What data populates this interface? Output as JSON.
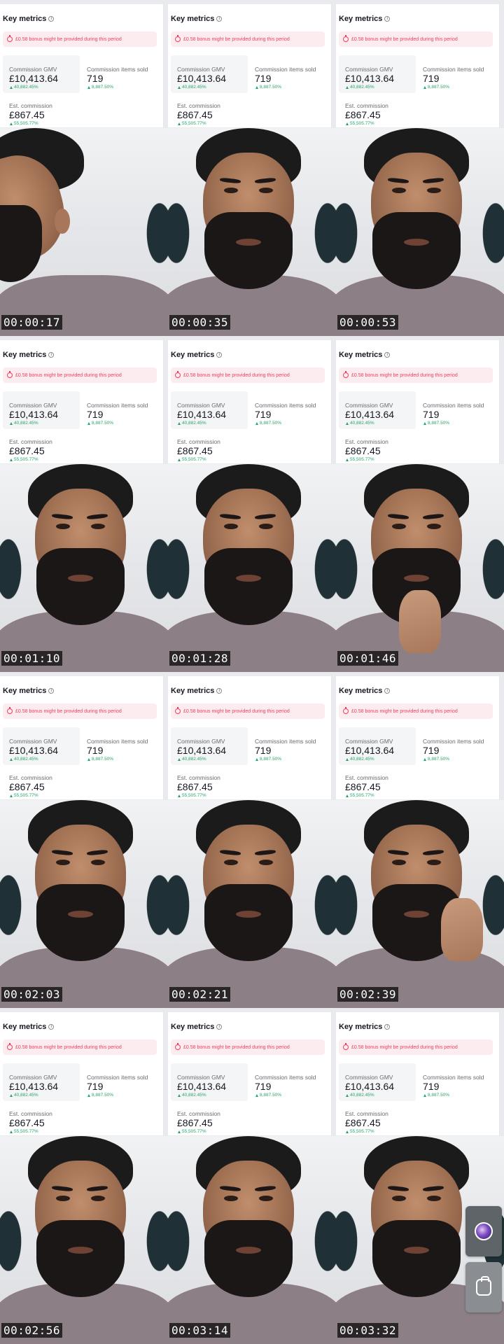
{
  "card": {
    "title": "Key metrics",
    "bonus_text": "£0.58 bonus might be provided during this period",
    "gmv_label": "Commission GMV",
    "gmv_value": "£10,413.64",
    "gmv_change": "40,882.45%",
    "items_label": "Commission items sold",
    "items_value": "719",
    "items_change": "8,887.50%",
    "est_label": "Est. commission",
    "est_value": "£867.45",
    "est_change": "55,505.77%"
  },
  "timestamps": [
    "00:00:17",
    "00:00:35",
    "00:00:53",
    "00:01:10",
    "00:01:28",
    "00:01:46",
    "00:02:03",
    "00:02:21",
    "00:02:39",
    "00:02:56",
    "00:03:14",
    "00:03:32"
  ],
  "colors": {
    "accent_red": "#e8435f",
    "positive_green": "#27a568",
    "card_bg": "#ffffff"
  },
  "icons": {
    "info": "info-icon",
    "bonus": "bonus-alert-icon",
    "up": "up-arrow-icon",
    "floating_1": "avatar-icon",
    "floating_2": "shopping-bag-icon"
  }
}
